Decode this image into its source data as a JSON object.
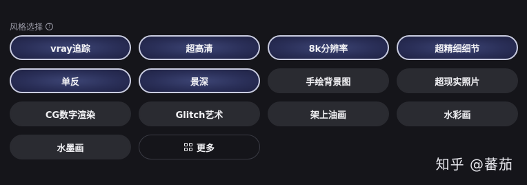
{
  "section": {
    "label": "风格选择",
    "help_symbol": "?"
  },
  "styles": [
    {
      "label": "vray追踪",
      "selected": true
    },
    {
      "label": "超高清",
      "selected": true
    },
    {
      "label": "8k分辨率",
      "selected": true
    },
    {
      "label": "超精细细节",
      "selected": true
    },
    {
      "label": "单反",
      "selected": true
    },
    {
      "label": "景深",
      "selected": true
    },
    {
      "label": "手绘背景图",
      "selected": false
    },
    {
      "label": "超现实照片",
      "selected": false
    },
    {
      "label": "CG数字渲染",
      "selected": false
    },
    {
      "label": "Glitch艺术",
      "selected": false
    },
    {
      "label": "架上油画",
      "selected": false
    },
    {
      "label": "水彩画",
      "selected": false
    },
    {
      "label": "水墨画",
      "selected": false
    }
  ],
  "more": {
    "label": "更多",
    "icon": "grid-icon"
  },
  "watermark": "知乎 @蕃茄",
  "colors": {
    "background": "#15151a",
    "selected_fill": "#2a2f58",
    "selected_border": "#c9cce0",
    "unselected_fill": "#2a2b31"
  }
}
